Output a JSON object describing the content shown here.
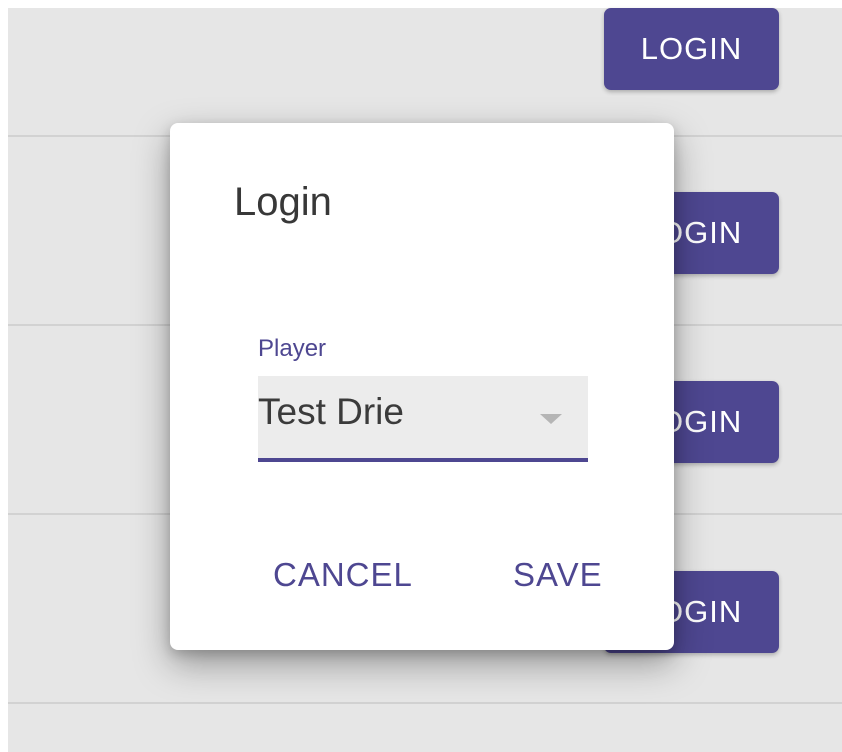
{
  "background_list": {
    "row_button_label": "LOGIN",
    "row_button_label_partial": "GIN"
  },
  "dialog": {
    "title": "Login",
    "player_field": {
      "label": "Player",
      "value": "Test Drie"
    },
    "actions": {
      "cancel_label": "CANCEL",
      "save_label": "SAVE"
    }
  },
  "colors": {
    "accent": "#4e4791",
    "backdrop": "#e6e6e6",
    "dialog_bg": "#ffffff"
  }
}
